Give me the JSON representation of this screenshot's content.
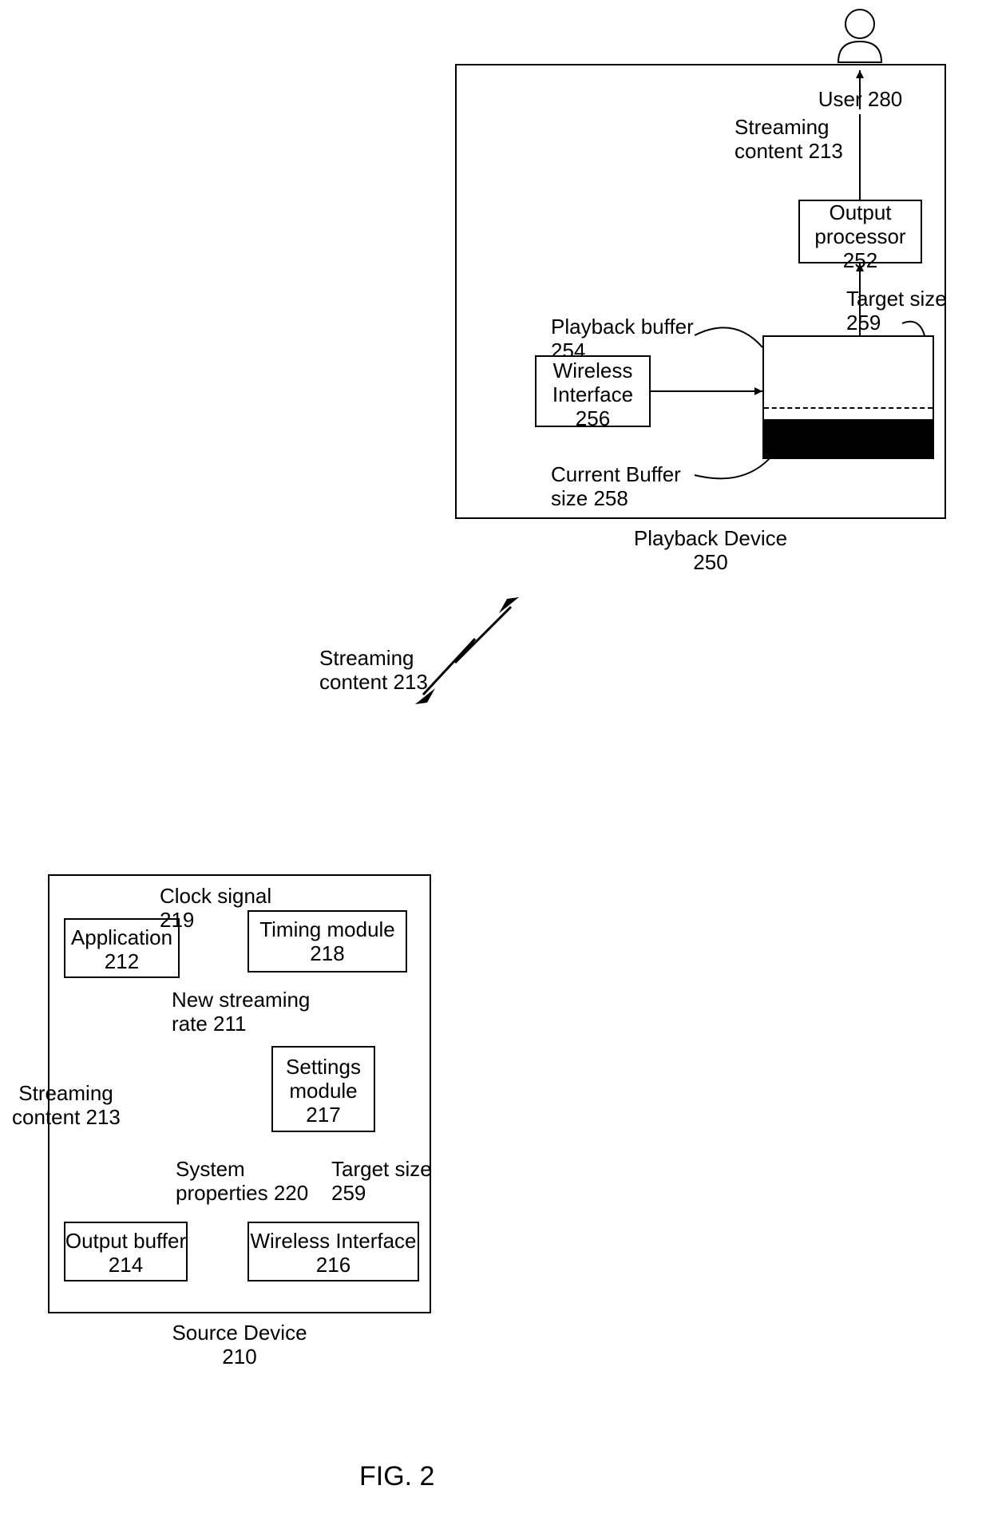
{
  "figure_caption": "FIG. 2",
  "user": {
    "label": "User 280"
  },
  "playback_device": {
    "title": "Playback Device\n250",
    "output_processor": "Output\nprocessor\n252",
    "wireless_interface": "Wireless\nInterface\n256",
    "playback_buffer": "Playback buffer\n254",
    "current_buffer_size": "Current Buffer\nsize 258",
    "target_size": "Target size\n259",
    "streaming_content": "Streaming\ncontent 213"
  },
  "between": {
    "streaming_content": "Streaming\ncontent 213"
  },
  "source_device": {
    "title": "Source Device\n210",
    "application": "Application\n212",
    "output_buffer": "Output buffer\n214",
    "timing_module": "Timing module\n218",
    "settings_module": "Settings\nmodule\n217",
    "wireless_interface": "Wireless Interface\n216",
    "clock_signal": "Clock signal\n219",
    "new_streaming_rate": "New streaming\nrate 211",
    "streaming_content": "Streaming\ncontent 213",
    "system_properties": "System\nproperties 220",
    "target_size": "Target size\n259"
  }
}
